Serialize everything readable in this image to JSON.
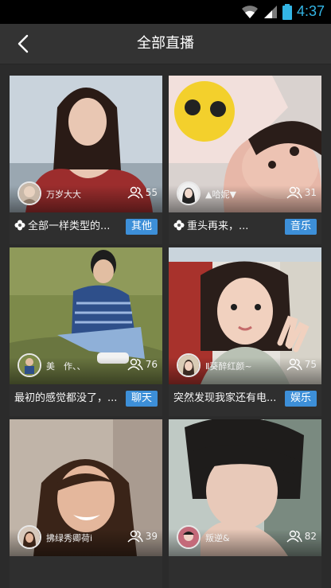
{
  "status": {
    "time": "4:37"
  },
  "header": {
    "title": "全部直播"
  },
  "cards": [
    {
      "host": "万岁大大",
      "viewers": "55",
      "caption": "全部一样类型的...",
      "tag": "其他",
      "has_flower": true
    },
    {
      "host": "▲哈妮▼",
      "viewers": "31",
      "caption": "重头再来，...",
      "tag": "音乐",
      "has_flower": true
    },
    {
      "host": "美　作、、",
      "viewers": "76",
      "caption": "最初的感觉都没了，...",
      "tag": "聊天",
      "has_flower": false
    },
    {
      "host": "Ⅱ葵醉红颜~",
      "viewers": "75",
      "caption": "突然发现我家还有电...",
      "tag": "娱乐",
      "has_flower": false
    },
    {
      "host": "拂绿秀卿荷i",
      "viewers": "39",
      "caption": "",
      "tag": "",
      "has_flower": false
    },
    {
      "host": "叛逆&",
      "viewers": "82",
      "caption": "",
      "tag": "",
      "has_flower": false
    }
  ],
  "colors": {
    "accent": "#3d8fd8",
    "status_blue": "#33b5e5",
    "appbar": "#333333"
  },
  "icons": {
    "back": "chevron-left-icon",
    "viewers": "people-icon",
    "caption": "flower-icon"
  }
}
